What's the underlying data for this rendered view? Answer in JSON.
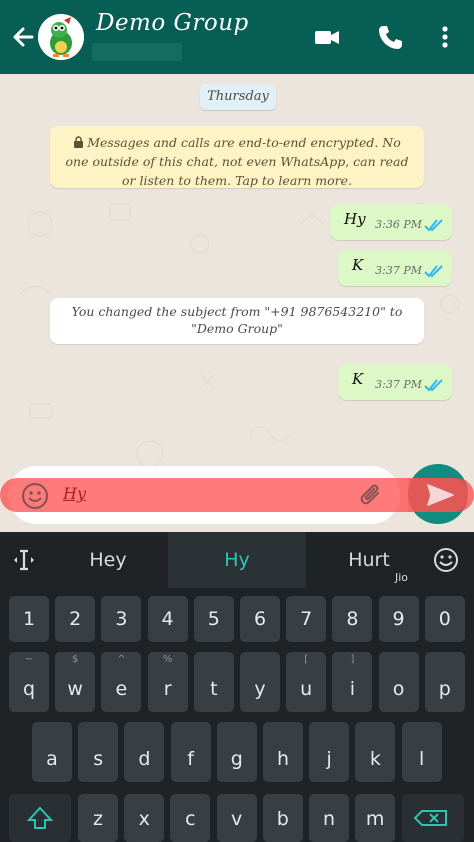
{
  "header": {
    "title": "Demo Group",
    "back_icon": "arrow-left-icon",
    "video_icon": "video-call-icon",
    "call_icon": "phone-icon",
    "menu_icon": "more-vert-icon",
    "bg_color": "#075e54"
  },
  "chat": {
    "day_label": "Thursday",
    "encryption_notice": "Messages and calls are end-to-end encrypted. No one outside of this chat, not even WhatsApp, can read or listen to them. Tap to learn more.",
    "system_message": "You changed the subject from \"+91 9876543210\" to \"Demo Group\"",
    "messages": [
      {
        "text": "Hy",
        "time": "3:36 PM"
      },
      {
        "text": "K",
        "time": "3:37 PM"
      },
      {
        "text": "K",
        "time": "3:37 PM"
      }
    ]
  },
  "composer": {
    "value": "Hy",
    "emoji_icon": "emoji-icon",
    "attach_icon": "paperclip-icon",
    "send_icon": "send-icon"
  },
  "keyboard": {
    "suggestions": [
      "Hey",
      "Hy",
      "Hurt"
    ],
    "carrier": "Jio",
    "row_numbers": [
      "1",
      "2",
      "3",
      "4",
      "5",
      "6",
      "7",
      "8",
      "9",
      "0"
    ],
    "row1": [
      {
        "k": "q",
        "a": "~"
      },
      {
        "k": "w",
        "a": "$"
      },
      {
        "k": "e",
        "a": "^"
      },
      {
        "k": "r",
        "a": "%"
      },
      {
        "k": "t",
        "a": ""
      },
      {
        "k": "y",
        "a": ""
      },
      {
        "k": "u",
        "a": "["
      },
      {
        "k": "i",
        "a": "]"
      },
      {
        "k": "o",
        "a": ""
      },
      {
        "k": "p",
        "a": ""
      }
    ],
    "row2": [
      {
        "k": "a",
        "a": ""
      },
      {
        "k": "s",
        "a": ""
      },
      {
        "k": "d",
        "a": ""
      },
      {
        "k": "f",
        "a": ""
      },
      {
        "k": "g",
        "a": ""
      },
      {
        "k": "h",
        "a": ""
      },
      {
        "k": "j",
        "a": ""
      },
      {
        "k": "k",
        "a": ""
      },
      {
        "k": "l",
        "a": ""
      }
    ],
    "row3": [
      "z",
      "x",
      "c",
      "v",
      "b",
      "n",
      "m"
    ]
  }
}
